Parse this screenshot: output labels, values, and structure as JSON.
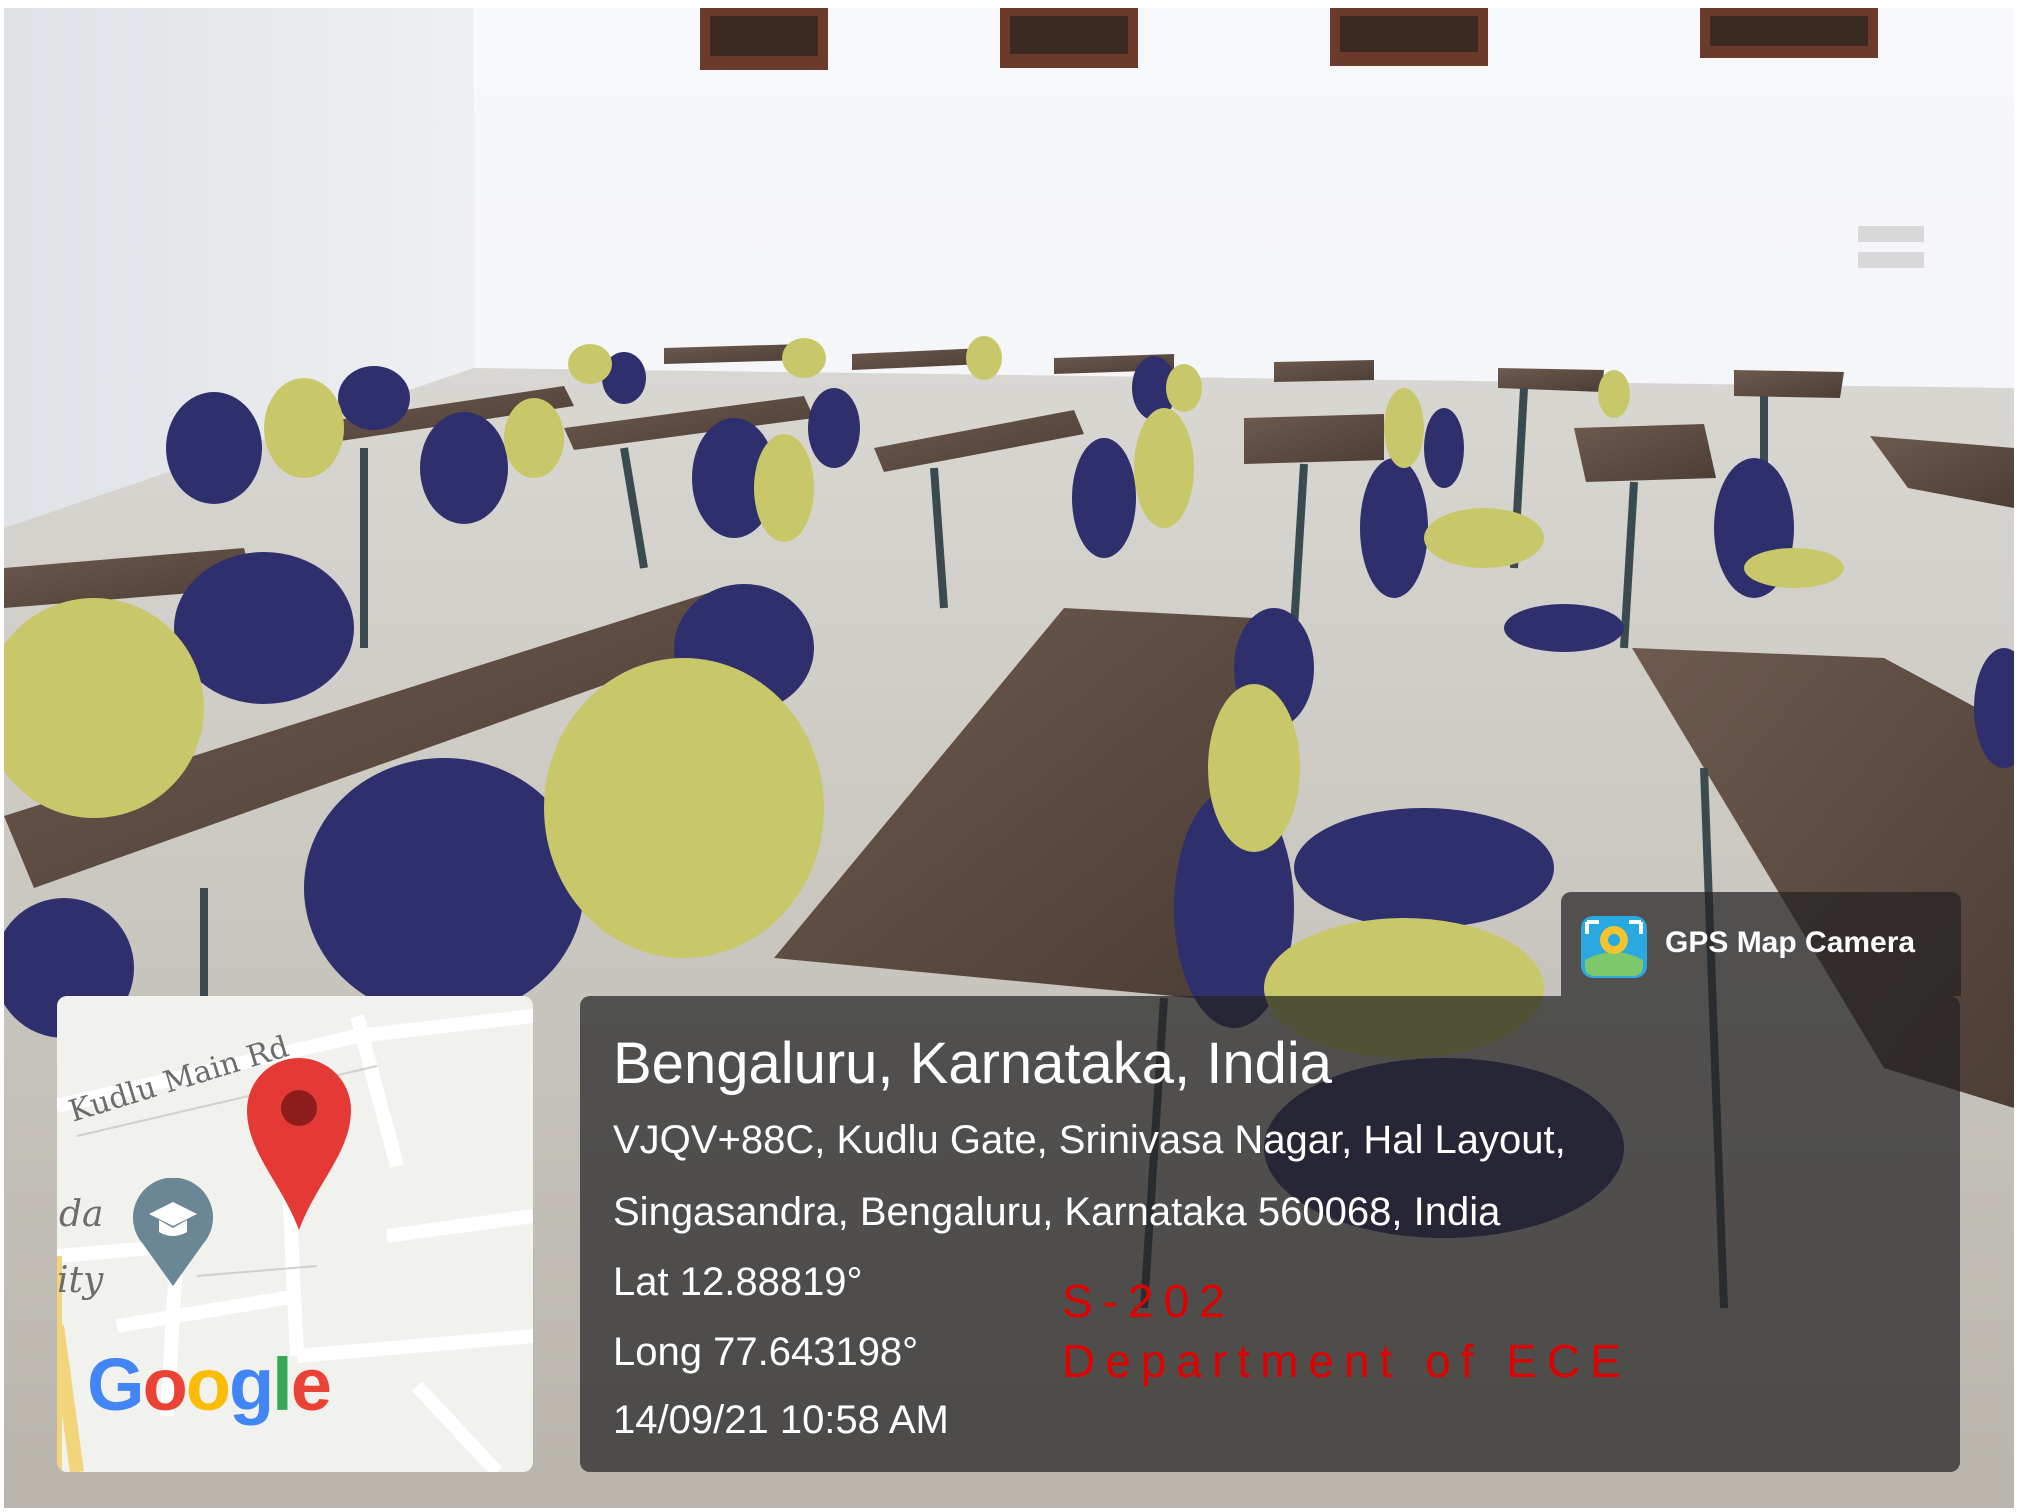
{
  "watermark": {
    "app_name": "GPS Map Camera",
    "app_icon": "gps-map-camera-icon"
  },
  "map": {
    "road_label": "Kudlu Main Rd",
    "partial_label_1": "da",
    "partial_label_2": "ity",
    "logo_text": "Google",
    "logo_colors": [
      "#4285F4",
      "#EA4335",
      "#FBBC05",
      "#4285F4",
      "#34A853",
      "#EA4335"
    ],
    "marker_icon": "location-pin-icon",
    "poi_icon": "education-graduation-cap-icon"
  },
  "location": {
    "title": "Bengaluru, Karnataka, India",
    "address_line_1": "VJQV+88C, Kudlu Gate, Srinivasa Nagar, Hal Layout,",
    "address_line_2": "Singasandra, Bengaluru, Karnataka 560068, India",
    "lat": "Lat 12.88819°",
    "long": "Long 77.643198°",
    "datetime": "14/09/21 10:58 AM"
  },
  "annotation": {
    "room": "S-202",
    "department": "Department of ECE",
    "color": "#e00000"
  }
}
